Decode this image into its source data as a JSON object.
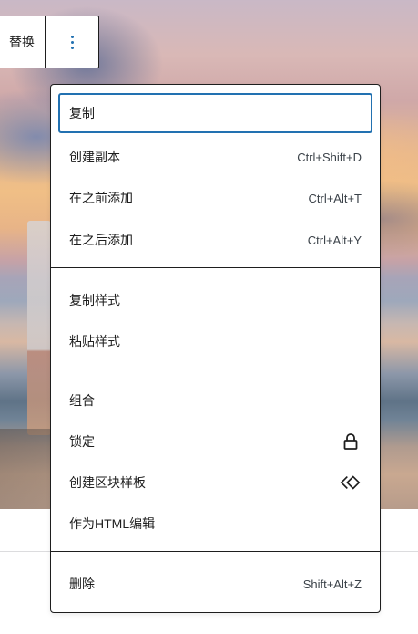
{
  "toolbar": {
    "replace_label": "替换",
    "options_icon": "more-vertical-icon"
  },
  "menu": {
    "section1": [
      {
        "label": "复制",
        "shortcut": ""
      },
      {
        "label": "创建副本",
        "shortcut": "Ctrl+Shift+D"
      },
      {
        "label": "在之前添加",
        "shortcut": "Ctrl+Alt+T"
      },
      {
        "label": "在之后添加",
        "shortcut": "Ctrl+Alt+Y"
      }
    ],
    "section2": [
      {
        "label": "复制样式"
      },
      {
        "label": "粘贴样式"
      }
    ],
    "section3": [
      {
        "label": "组合"
      },
      {
        "label": "锁定",
        "icon": "lock-icon"
      },
      {
        "label": "创建区块样板",
        "icon": "pattern-diamond-icon"
      },
      {
        "label": "作为HTML编辑"
      }
    ],
    "section4": [
      {
        "label": "删除",
        "shortcut": "Shift+Alt+Z"
      }
    ]
  },
  "colors": {
    "focus_ring": "#2271b1",
    "border": "#1e1e1e"
  }
}
